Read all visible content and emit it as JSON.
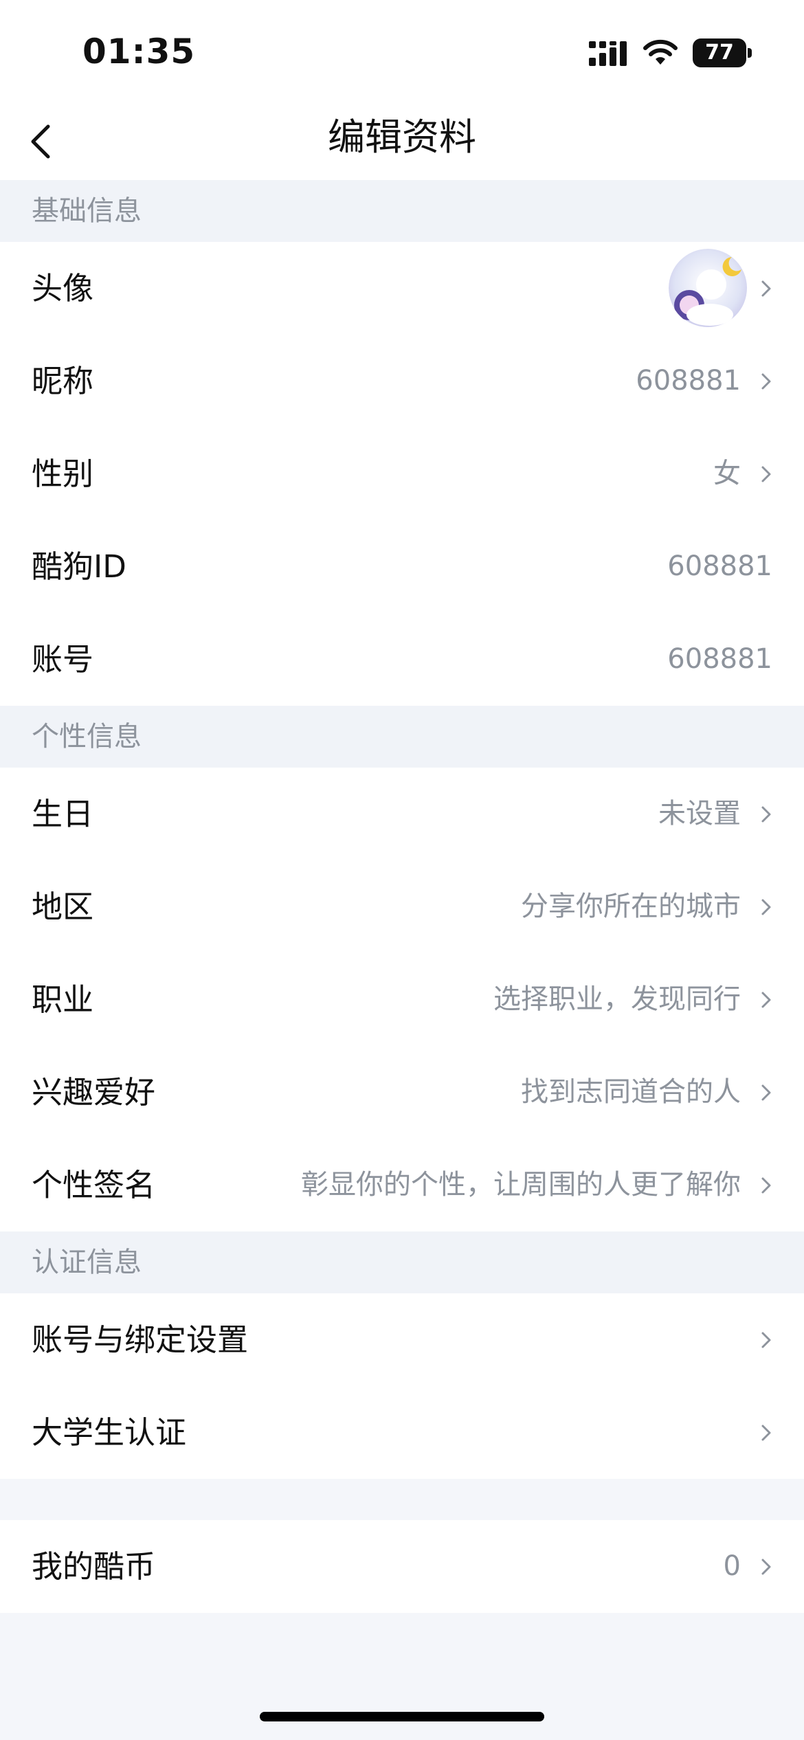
{
  "status_bar": {
    "time": "01:35",
    "battery": "77"
  },
  "nav": {
    "title": "编辑资料"
  },
  "sections": {
    "basic": {
      "header": "基础信息",
      "avatar_label": "头像",
      "nickname": {
        "label": "昵称",
        "value": "608881"
      },
      "gender": {
        "label": "性别",
        "value": "女"
      },
      "kugou_id": {
        "label": "酷狗ID",
        "value": "608881"
      },
      "account": {
        "label": "账号",
        "value": "608881"
      }
    },
    "personal": {
      "header": "个性信息",
      "birthday": {
        "label": "生日",
        "value": "未设置"
      },
      "region": {
        "label": "地区",
        "value": "分享你所在的城市"
      },
      "occupation": {
        "label": "职业",
        "value": "选择职业，发现同行"
      },
      "hobbies": {
        "label": "兴趣爱好",
        "value": "找到志同道合的人"
      },
      "signature": {
        "label": "个性签名",
        "value": "彰显你的个性，让周围的人更了解你"
      }
    },
    "verification": {
      "header": "认证信息",
      "binding": {
        "label": "账号与绑定设置"
      },
      "student": {
        "label": "大学生认证"
      }
    },
    "coins": {
      "label": "我的酷币",
      "value": "0"
    }
  },
  "colors": {
    "background": "#f4f6fa",
    "card": "#ffffff",
    "secondary_text": "#8d939c",
    "primary_text": "#111111"
  },
  "icons": [
    "back-chevron-icon",
    "chevron-right-icon",
    "cellular-signal-icon",
    "wifi-icon",
    "battery-icon"
  ]
}
